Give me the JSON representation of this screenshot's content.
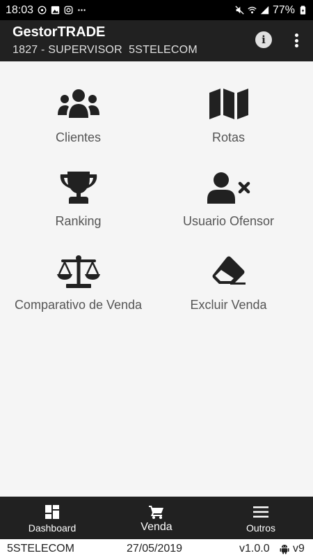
{
  "status_bar": {
    "time": "18:03",
    "battery_percent": "77%",
    "notification_icons": [
      "whatsapp-icon",
      "image-icon",
      "instagram-icon",
      "more-icon"
    ],
    "system_icons": [
      "mute-icon",
      "wifi-icon",
      "signal-icon",
      "battery-icon"
    ]
  },
  "app_bar": {
    "title": "GestorTRADE",
    "subtitle": "1827 - SUPERVISOR  5STELECOM",
    "actions": [
      "info-icon",
      "overflow-menu-icon"
    ]
  },
  "menu": {
    "items": [
      {
        "label": "Clientes",
        "icon": "users-icon"
      },
      {
        "label": "Rotas",
        "icon": "map-icon"
      },
      {
        "label": "Ranking",
        "icon": "trophy-icon"
      },
      {
        "label": "Usuario Ofensor",
        "icon": "user-remove-icon"
      },
      {
        "label": "Comparativo de Venda",
        "icon": "balance-scale-icon"
      },
      {
        "label": "Excluir Venda",
        "icon": "eraser-icon"
      }
    ]
  },
  "bottom_nav": {
    "items": [
      {
        "label": "Dashboard",
        "icon": "dashboard-icon"
      },
      {
        "label": "Venda",
        "icon": "cart-icon",
        "active": true
      },
      {
        "label": "Outros",
        "icon": "hamburger-menu-icon"
      }
    ]
  },
  "footer": {
    "company": "5STELECOM",
    "date": "27/05/2019",
    "version": "v1.0.0",
    "android_version": "v9"
  },
  "colors": {
    "app_bar": "#212121",
    "background": "#f5f5f5",
    "icon": "#212121",
    "label": "#555555"
  }
}
